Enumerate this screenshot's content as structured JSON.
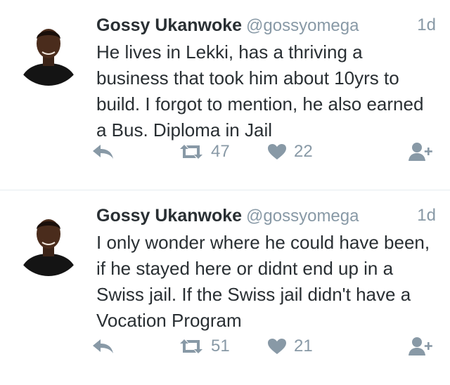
{
  "tweets": [
    {
      "name": "Gossy Ukanwoke",
      "handle": "@gossyomega",
      "time": "1d",
      "text": "He lives in Lekki, has a thriving a business that took him about 10yrs to build.  I forgot to mention, he also earned a Bus. Diploma in Jail",
      "retweets": "47",
      "likes": "22"
    },
    {
      "name": "Gossy Ukanwoke",
      "handle": "@gossyomega",
      "time": "1d",
      "text": "I only wonder where he could have been, if he stayed here or didnt end up in a Swiss jail. If the Swiss jail didn't have a Vocation Program",
      "retweets": "51",
      "likes": "21"
    }
  ],
  "icons": {
    "reply": "reply-icon",
    "retweet": "retweet-icon",
    "like": "heart-icon",
    "follow": "follow-icon"
  },
  "colors": {
    "name": "#292f33",
    "muted": "#8899a6",
    "divider": "#e6ecf0"
  }
}
